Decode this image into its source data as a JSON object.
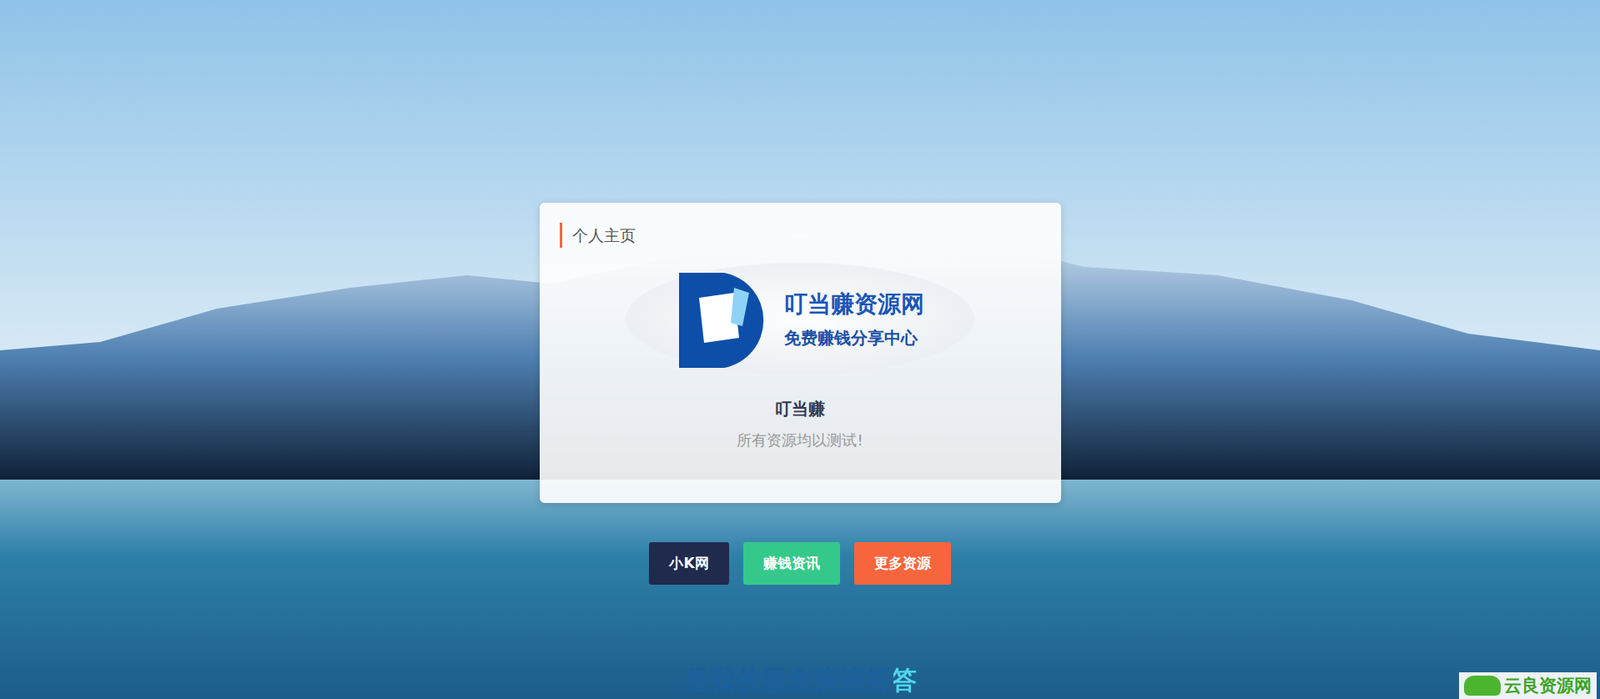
{
  "page": {
    "title": "个人主页"
  },
  "logo": {
    "name": "叮当赚资源网",
    "slogan": "免费赚钱分享中心"
  },
  "profile": {
    "name": "叮当赚",
    "motto": "所有资源均以测试!"
  },
  "links": [
    {
      "label": "小K网",
      "color": "#1f2a4d"
    },
    {
      "label": "赚钱资讯",
      "color": "#34c98a"
    },
    {
      "label": "更多资源",
      "color": "#f7653d"
    }
  ],
  "lyric": {
    "text": "是我的思念滴滴答答",
    "level": 0.9
  },
  "watermark": {
    "text": "云良资源网"
  }
}
